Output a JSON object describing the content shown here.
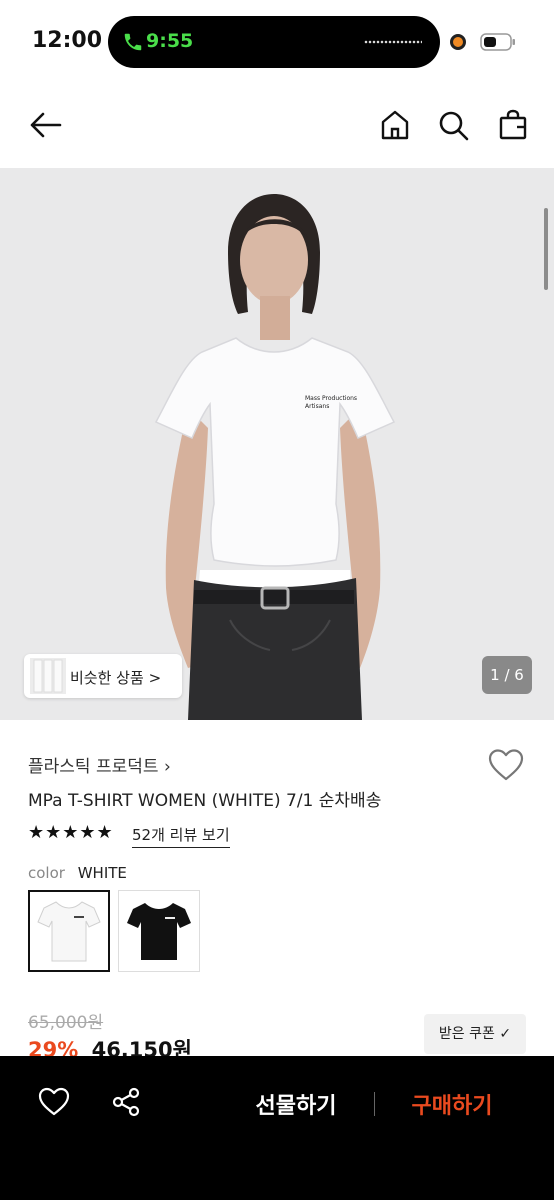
{
  "status_bar": {
    "time": "12:00",
    "call_time": "9:55",
    "call_color": "#4ade4a"
  },
  "nav": {
    "icons": [
      "back-arrow-icon",
      "home-icon",
      "search-icon",
      "shopping-bag-icon"
    ]
  },
  "gallery": {
    "similar_label": "비슷한 상품",
    "similar_chevron": ">",
    "counter": "1 / 6"
  },
  "product": {
    "brand": "플라스틱 프로덕트",
    "brand_chevron": "›",
    "title": "MPa T-SHIRT WOMEN (WHITE) 7/1 순차배송",
    "stars": "★★★★★",
    "rating_stars": 5,
    "review_link": "52개 리뷰 보기",
    "color_key": "color",
    "color_value": "WHITE",
    "color_options": [
      "WHITE",
      "BLACK"
    ],
    "original_price": "65,000원",
    "discount_pct": "29%",
    "final_price": "46,150원",
    "coupon_label": "받은 쿠폰 ✓"
  },
  "bottom_bar": {
    "gift_label": "선물하기",
    "buy_label": "구매하기",
    "accent": "#ea4a1f"
  }
}
